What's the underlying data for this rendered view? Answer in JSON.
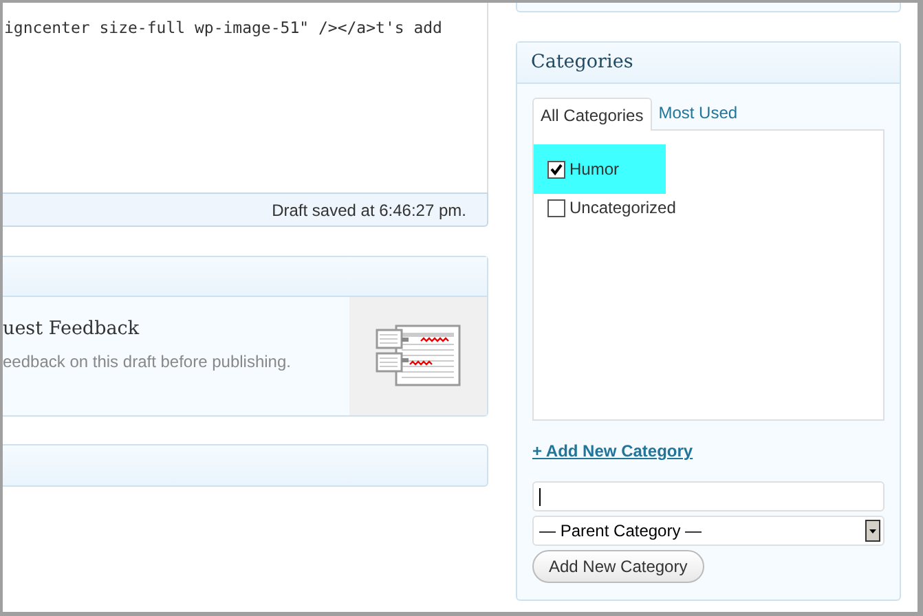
{
  "editor": {
    "text": "igncenter size-full wp-image-51\" /></a>t's add",
    "status": "Draft saved at 6:46:27 pm."
  },
  "feedback": {
    "title": "uest Feedback",
    "description": "eedback on this draft before publishing."
  },
  "categories": {
    "title": "Categories",
    "tabs": [
      {
        "label": "All Categories",
        "selected": true
      },
      {
        "label": "Most Used",
        "selected": false
      }
    ],
    "items": [
      {
        "label": "Humor",
        "checked": true,
        "highlighted": true
      },
      {
        "label": "Uncategorized",
        "checked": false,
        "highlighted": false
      }
    ],
    "add_link": "+ Add New Category",
    "parent_select": "— Parent Category —",
    "add_button": "Add New Category"
  }
}
